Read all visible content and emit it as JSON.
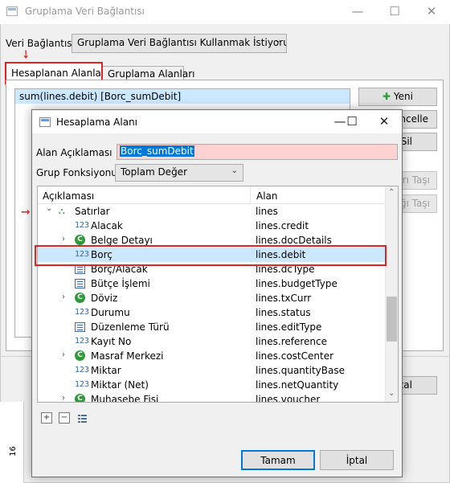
{
  "parent": {
    "title": "Gruplama Veri Bağlantısı",
    "window_controls": {
      "minimize": "—",
      "maximize": "☐",
      "close": "✕"
    },
    "veri_label": "Veri Bağlantısı",
    "veri_value": "Gruplama Veri Bağlantısı Kullanmak İstiyorum",
    "tabs": [
      {
        "label": "Hesaplanan Alanlar",
        "active": true
      },
      {
        "label": "Gruplama Alanları",
        "active": false
      }
    ],
    "list_item": "sum(lines.debit) [Borc_sumDebit]",
    "buttons": {
      "yeni": "Yeni",
      "guncelle": "ncelle",
      "sil": "Sil",
      "yukari": "arı Taşı",
      "asagi": "ağı Taşı",
      "tal": "tal"
    },
    "ruler_label": "16"
  },
  "dialog": {
    "title": "Hesaplama Alanı",
    "window_controls": {
      "minimize": "—",
      "maximize": "☐",
      "close": "✕"
    },
    "alan_label": "Alan Açıklaması",
    "alan_value": "Borc_sumDebit",
    "grup_label": "Grup Fonksiyonu",
    "grup_value": "Toplam Değer",
    "columns": {
      "aciklama": "Açıklaması",
      "alan": "Alan"
    },
    "rows": [
      {
        "label": "Satırlar",
        "alan": "lines",
        "icon": "tree-icon",
        "expander": "⌄",
        "level": 0,
        "selected": false
      },
      {
        "label": "Alacak",
        "alan": "lines.credit",
        "icon": "number-icon",
        "expander": "",
        "level": 1,
        "selected": false
      },
      {
        "label": "Belge Detayı",
        "alan": "lines.docDetails",
        "icon": "class-icon",
        "expander": "›",
        "level": 1,
        "selected": false
      },
      {
        "label": "Borç",
        "alan": "lines.debit",
        "icon": "number-icon",
        "expander": "",
        "level": 1,
        "selected": true
      },
      {
        "label": "Borç/Alacak",
        "alan": "lines.dcType",
        "icon": "list-icon",
        "expander": "",
        "level": 1,
        "selected": false
      },
      {
        "label": "Bütçe İşlemi",
        "alan": "lines.budgetType",
        "icon": "list-icon",
        "expander": "",
        "level": 1,
        "selected": false
      },
      {
        "label": "Döviz",
        "alan": "lines.txCurr",
        "icon": "class-icon",
        "expander": "›",
        "level": 1,
        "selected": false
      },
      {
        "label": "Durumu",
        "alan": "lines.status",
        "icon": "number-icon",
        "expander": "",
        "level": 1,
        "selected": false
      },
      {
        "label": "Düzenleme Türü",
        "alan": "lines.editType",
        "icon": "list-icon",
        "expander": "",
        "level": 1,
        "selected": false
      },
      {
        "label": "Kayıt No",
        "alan": "lines.reference",
        "icon": "number-icon",
        "expander": "",
        "level": 1,
        "selected": false
      },
      {
        "label": "Masraf Merkezi",
        "alan": "lines.costCenter",
        "icon": "class-icon",
        "expander": "›",
        "level": 1,
        "selected": false
      },
      {
        "label": "Miktar",
        "alan": "lines.quantityBase",
        "icon": "number-icon",
        "expander": "",
        "level": 1,
        "selected": false
      },
      {
        "label": "Miktar (Net)",
        "alan": "lines.netQuantity",
        "icon": "number-icon",
        "expander": "",
        "level": 1,
        "selected": false
      },
      {
        "label": "Muhasebe Fisi",
        "alan": "lines.voucher",
        "icon": "class-icon",
        "expander": "›",
        "level": 1,
        "selected": false
      }
    ],
    "icon_glyphs": {
      "number_icon": "123",
      "class_icon": "C",
      "tree_icon": "⛬"
    },
    "scroll": {
      "up": "⌃",
      "down": "⌄"
    },
    "tools": {
      "expand": "+",
      "collapse": "−"
    },
    "ok_label": "Tamam",
    "cancel_label": "İptal"
  },
  "colors": {
    "highlight": "#e32222",
    "selection": "#0078d7",
    "pink_field": "#ffd2d2",
    "green_icon": "#2e9b3a"
  }
}
